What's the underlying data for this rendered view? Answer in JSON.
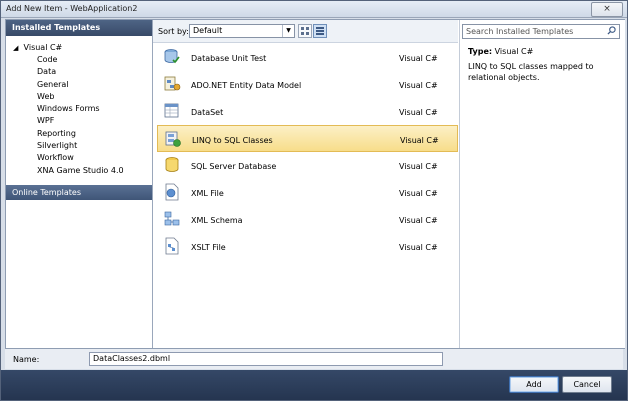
{
  "window": {
    "title": "Add New Item - WebApplication2",
    "close_label": "×"
  },
  "left": {
    "header": "Installed Templates",
    "root": {
      "label": "Visual C#",
      "expander": "◢"
    },
    "items": [
      "Code",
      "Data",
      "General",
      "Web",
      "Windows Forms",
      "WPF",
      "Reporting",
      "Silverlight",
      "Workflow",
      "XNA Game Studio 4.0"
    ],
    "online": "Online Templates"
  },
  "toolbar": {
    "sort_label": "Sort by:",
    "sort_value": "Default"
  },
  "templates": [
    {
      "name": "Database Unit Test",
      "type": "Visual C#",
      "icon": "database-unit-test-icon"
    },
    {
      "name": "ADO.NET Entity Data Model",
      "type": "Visual C#",
      "icon": "entity-model-icon"
    },
    {
      "name": "DataSet",
      "type": "Visual C#",
      "icon": "dataset-icon"
    },
    {
      "name": "LINQ to SQL Classes",
      "type": "Visual C#",
      "icon": "linq-icon",
      "selected": true
    },
    {
      "name": "SQL Server Database",
      "type": "Visual C#",
      "icon": "sql-database-icon"
    },
    {
      "name": "XML File",
      "type": "Visual C#",
      "icon": "xml-file-icon"
    },
    {
      "name": "XML Schema",
      "type": "Visual C#",
      "icon": "xml-schema-icon"
    },
    {
      "name": "XSLT File",
      "type": "Visual C#",
      "icon": "xslt-file-icon"
    }
  ],
  "details": {
    "search_placeholder": "Search Installed Templates",
    "type_label": "Type:",
    "type_value": "Visual C#",
    "description": "LINQ to SQL classes mapped to relational objects."
  },
  "name_field": {
    "label": "Name:",
    "value": "DataClasses2.dbml"
  },
  "buttons": {
    "add": "Add",
    "cancel": "Cancel"
  },
  "colors": {
    "header_bg": "#384a68",
    "selected_row": "#f7dd8a",
    "footer_bg": "#253550"
  }
}
